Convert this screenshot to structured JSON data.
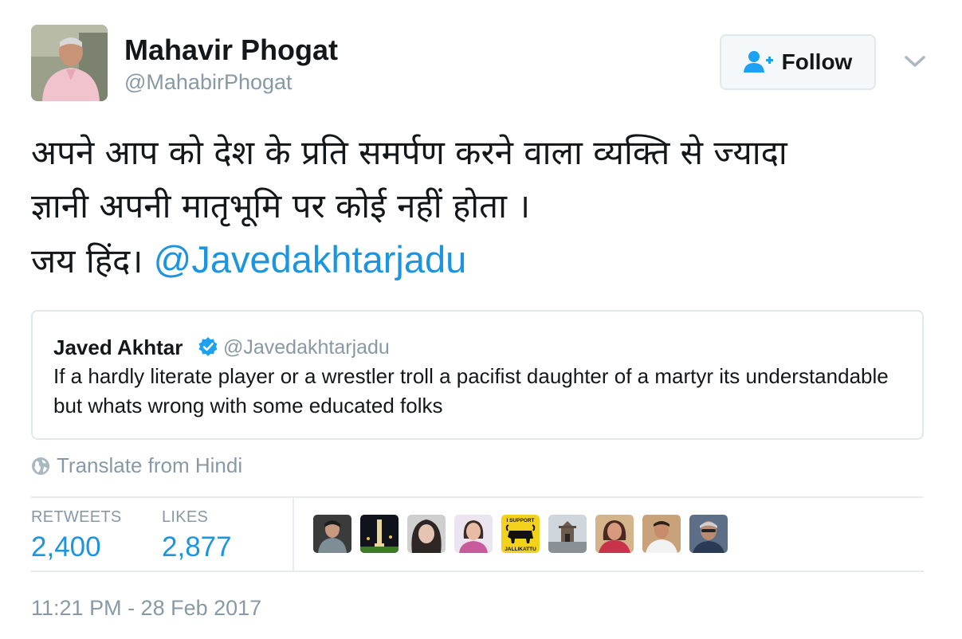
{
  "author": {
    "display_name": "Mahavir Phogat",
    "handle": "@MahabirPhogat",
    "avatar_icon": "person-avatar"
  },
  "follow_button": {
    "label": "Follow",
    "icon": "add-user-icon",
    "icon_color": "#1da1f2"
  },
  "menu_caret_icon": "chevron-down-icon",
  "tweet": {
    "line1": "अपने आप को देश के प्रति समर्पण करने वाला व्यक्ति से ज्यादा",
    "line2": "ज्ञानी अपनी मातृभूमि पर कोई नहीं होता  ।",
    "line3_text": "जय हिंद।",
    "mention": "@Javedakhtarjadu"
  },
  "quoted_tweet": {
    "name": "Javed Akhtar",
    "verified_icon": "verified-badge-icon",
    "handle": "@Javedakhtarjadu",
    "text": "If a hardly literate player or a wrestler troll a pacifist daughter of a martyr its understandable but whats wrong with some educated folks"
  },
  "translate": {
    "label": "Translate from Hindi",
    "icon": "globe-icon"
  },
  "stats": {
    "retweets_label": "RETWEETS",
    "retweets_value": "2,400",
    "likes_label": "LIKES",
    "likes_value": "2,877"
  },
  "likers": [
    {
      "name": "liker-avatar-1",
      "icon": "person-avatar"
    },
    {
      "name": "liker-avatar-2",
      "icon": "landmark-night-avatar"
    },
    {
      "name": "liker-avatar-3",
      "icon": "person-avatar"
    },
    {
      "name": "liker-avatar-4",
      "icon": "person-avatar"
    },
    {
      "name": "liker-avatar-5",
      "icon": "bull-avatar",
      "badge_top": "I SUPPORT",
      "badge_bottom": "JALLIKATTU"
    },
    {
      "name": "liker-avatar-6",
      "icon": "building-avatar"
    },
    {
      "name": "liker-avatar-7",
      "icon": "person-avatar"
    },
    {
      "name": "liker-avatar-8",
      "icon": "person-avatar"
    },
    {
      "name": "liker-avatar-9",
      "icon": "person-avatar"
    }
  ],
  "timestamp": "11:21 PM - 28 Feb 2017",
  "colors": {
    "link": "#1b95e0",
    "muted": "#8899a6",
    "border": "#e1e8ed",
    "verified": "#1da1f2"
  }
}
